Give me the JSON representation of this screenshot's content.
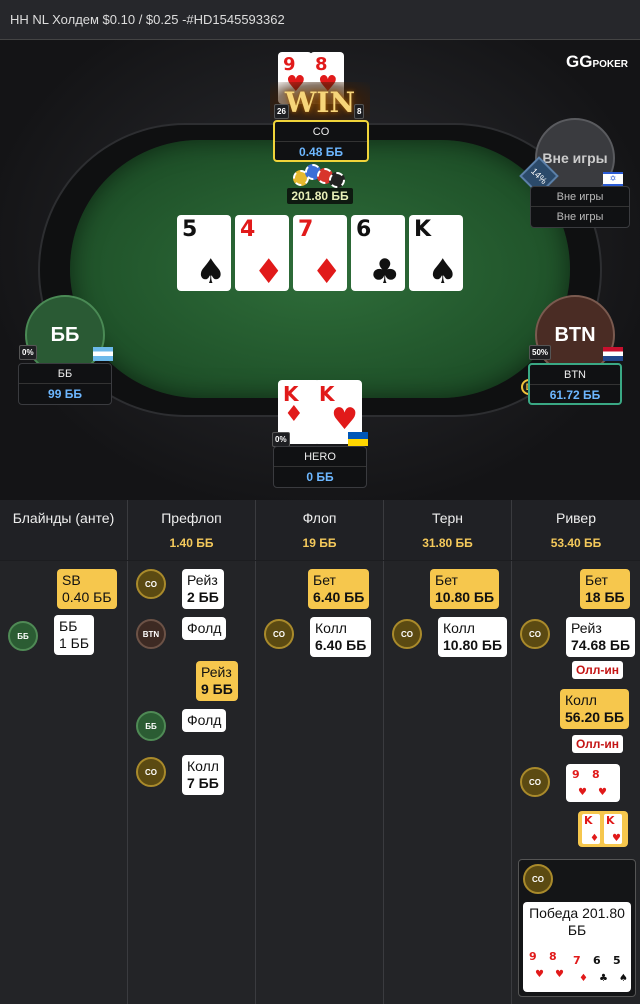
{
  "header": {
    "title": "HH NL Холдем $0.10 / $0.25 -#HD1545593362"
  },
  "logo": {
    "gg": "GG",
    "poker": "POKER"
  },
  "board": [
    {
      "rank": "5",
      "suit": "♠",
      "color": "black"
    },
    {
      "rank": "4",
      "suit": "♦",
      "color": "red"
    },
    {
      "rank": "7",
      "suit": "♦",
      "color": "red"
    },
    {
      "rank": "6",
      "suit": "♣",
      "color": "black"
    },
    {
      "rank": "K",
      "suit": "♠",
      "color": "black"
    }
  ],
  "pot": "201.80 ББ",
  "seats": {
    "co": {
      "name": "CO",
      "stack": "0.48 ББ",
      "win": "WIN",
      "card1": "9",
      "card2": "8",
      "tag_left": "26",
      "tag_right": "8"
    },
    "sitout": {
      "circle": "Вне игры",
      "name": "Вне игры",
      "stack": "Вне игры",
      "pct": "14%"
    },
    "bb": {
      "circle": "ББ",
      "name": "ББ",
      "stack": "99 ББ",
      "pct": "0%"
    },
    "btn": {
      "circle": "BTN",
      "name": "BTN",
      "stack": "61.72 ББ",
      "pct": "50%",
      "dealer": "D"
    },
    "hero": {
      "name": "HERO",
      "stack": "0 ББ",
      "pct": "0%",
      "card1": "K",
      "card2": "K"
    }
  },
  "streets": [
    {
      "title": "Блайнды (анте)",
      "pot": ""
    },
    {
      "title": "Префлоп",
      "pot": "1.40 ББ"
    },
    {
      "title": "Флоп",
      "pot": "19 ББ"
    },
    {
      "title": "Терн",
      "pot": "31.80 ББ"
    },
    {
      "title": "Ривер",
      "pot": "53.40 ББ"
    }
  ],
  "actions": {
    "blinds": {
      "sb_a": "SB",
      "sb_b": "0.40 ББ",
      "bb_a": "ББ",
      "bb_b": "1 ББ",
      "chip_bb": "ББ"
    },
    "preflop": {
      "co_a": "Рейз",
      "co_b": "2 ББ",
      "btn_a": "Фолд",
      "hero_a": "Рейз",
      "hero_b": "9 ББ",
      "bb_a": "Фолд",
      "co2_a": "Колл",
      "co2_b": "7 ББ",
      "chip_co": "CO",
      "chip_btn": "BTN",
      "chip_bb": "ББ"
    },
    "flop": {
      "hero_a": "Бет",
      "hero_b": "6.40 ББ",
      "co_a": "Колл",
      "co_b": "6.40 ББ",
      "chip_co": "CO"
    },
    "turn": {
      "hero_a": "Бет",
      "hero_b": "10.80 ББ",
      "co_a": "Колл",
      "co_b": "10.80 ББ",
      "chip_co": "CO"
    },
    "river": {
      "hero_a": "Бет",
      "hero_b": "18 ББ",
      "co_a": "Рейз",
      "co_b": "74.68 ББ",
      "co_allin": "Олл-ин",
      "hero2_a": "Колл",
      "hero2_b": "56.20 ББ",
      "hero2_allin": "Олл-ин",
      "chip_co": "CO",
      "win_text": "Победа 201.80 ББ"
    }
  }
}
